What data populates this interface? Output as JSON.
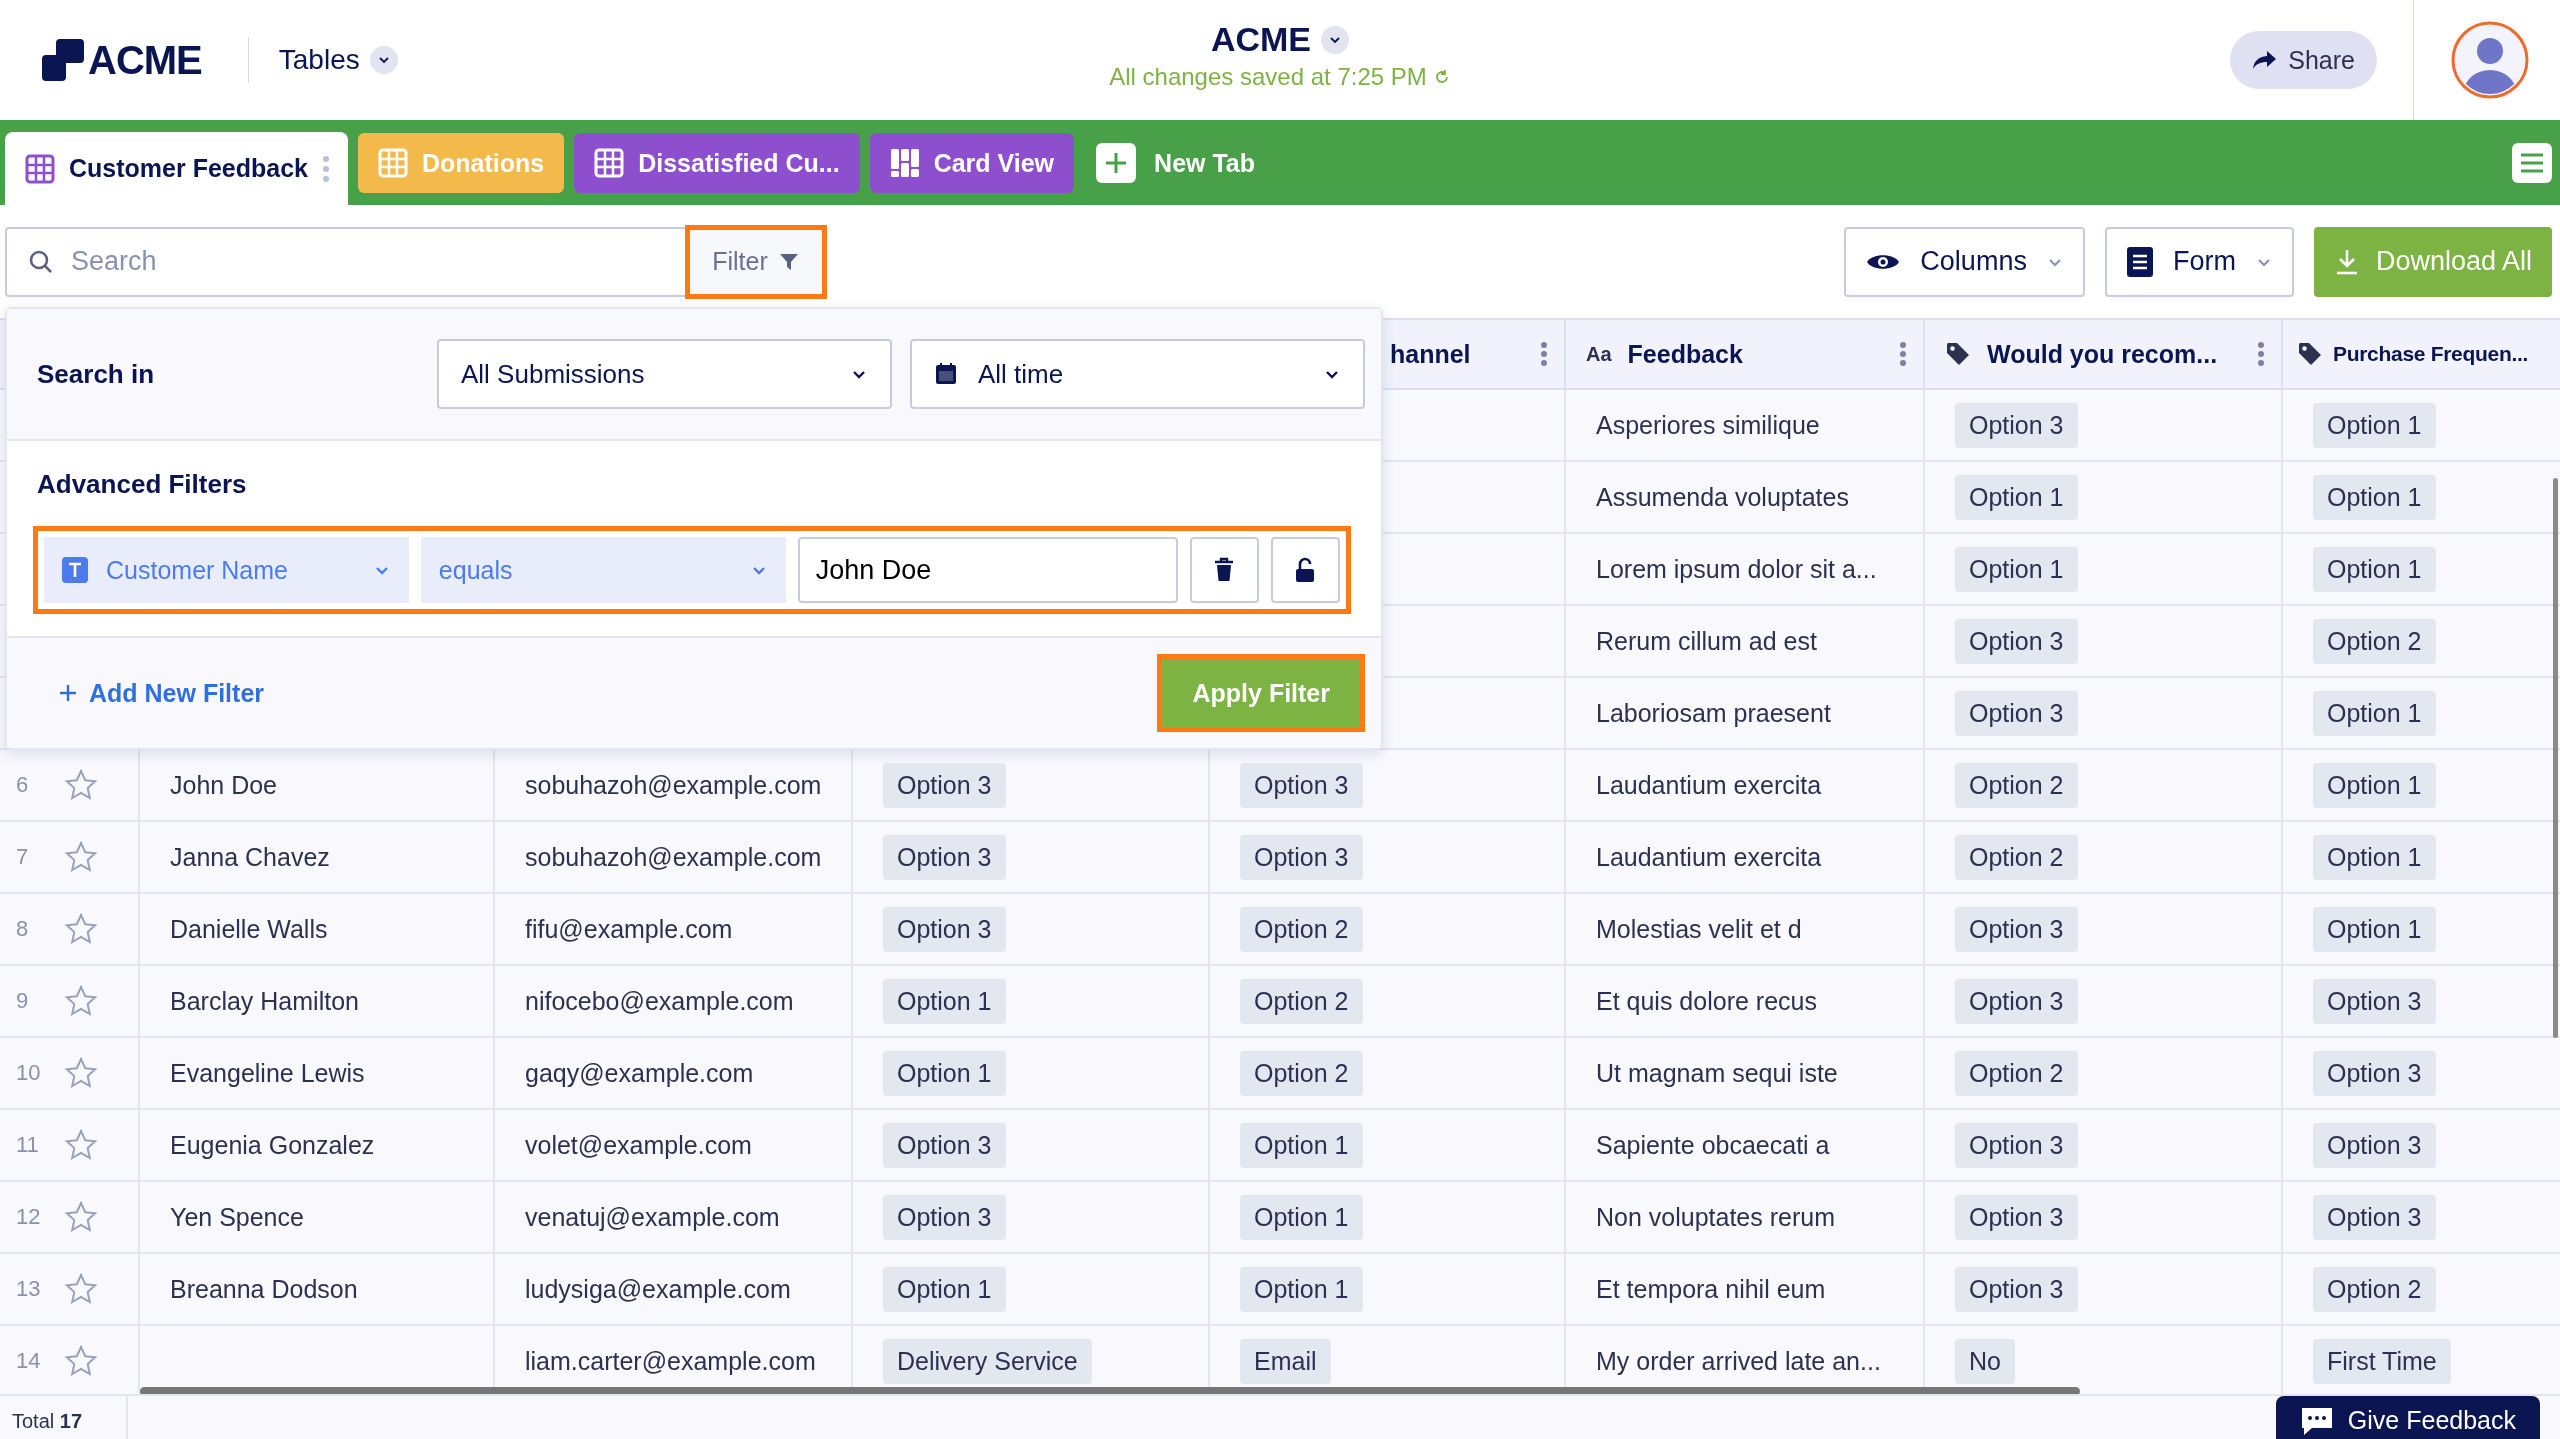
{
  "header": {
    "logo": "ACME",
    "app_menu": "Tables",
    "title": "ACME",
    "status": "All changes saved at 7:25 PM",
    "share": "Share"
  },
  "tabs": [
    {
      "label": "Customer Feedback",
      "kind": "grid",
      "color": "#8e4fcf",
      "selected": true
    },
    {
      "label": "Donations",
      "kind": "grid",
      "color": "#f3b94a",
      "selected": false
    },
    {
      "label": "Dissatisfied Cu...",
      "kind": "grid",
      "color": "#8e4fcf",
      "selected": false
    },
    {
      "label": "Card View",
      "kind": "cards",
      "color": "#8e4fcf",
      "selected": false
    }
  ],
  "new_tab": "New Tab",
  "toolbar": {
    "search": {
      "placeholder": "Search"
    },
    "filter": {
      "label": "Filter",
      "highlighted": true
    },
    "columns": "Columns",
    "form": "Form",
    "download": "Download All"
  },
  "filter_panel": {
    "search_in_label": "Search in",
    "scope": "All Submissions",
    "period": "All time",
    "advanced_label": "Advanced Filters",
    "filters": [
      {
        "field": "Customer Name",
        "operator": "equals",
        "value": "John Doe",
        "highlighted": true
      }
    ],
    "add_filter": "Add New Filter",
    "apply": {
      "label": "Apply Filter",
      "highlighted": true
    }
  },
  "table": {
    "columns": [
      {
        "kind": "text"
      },
      {
        "kind": "text"
      },
      {
        "kind": "tag"
      },
      {
        "kind": "tag",
        "label": "hannel"
      },
      {
        "kind": "text",
        "label": "Feedback",
        "glyph": "Aa"
      },
      {
        "kind": "tag",
        "label": "Would you recom..."
      },
      {
        "kind": "tag",
        "label": "Purchase Frequen..."
      }
    ],
    "rows": [
      {
        "cells": [
          null,
          null,
          null,
          null,
          "Asperiores similique",
          "Option 3",
          "Option 1"
        ]
      },
      {
        "cells": [
          null,
          null,
          null,
          null,
          "Assumenda voluptates",
          "Option 1",
          "Option 1"
        ]
      },
      {
        "cells": [
          null,
          null,
          null,
          null,
          "Lorem ipsum dolor sit a...",
          "Option 1",
          "Option 1"
        ]
      },
      {
        "cells": [
          null,
          null,
          null,
          null,
          "Rerum cillum ad est",
          "Option 3",
          "Option 2"
        ]
      },
      {
        "cells": [
          null,
          null,
          null,
          null,
          "Laboriosam praesent",
          "Option 3",
          "Option 1"
        ]
      },
      {
        "number": "6",
        "starred": false,
        "cells": [
          "John Doe",
          "sobuhazoh@example.com",
          "Option 3",
          "Option 3",
          "Laudantium exercita",
          "Option 2",
          "Option 1"
        ]
      },
      {
        "number": "7",
        "starred": false,
        "cells": [
          "Janna Chavez",
          "sobuhazoh@example.com",
          "Option 3",
          "Option 3",
          "Laudantium exercita",
          "Option 2",
          "Option 1"
        ]
      },
      {
        "number": "8",
        "starred": false,
        "cells": [
          "Danielle Walls",
          "fifu@example.com",
          "Option 3",
          "Option 2",
          "Molestias velit et d",
          "Option 3",
          "Option 1"
        ]
      },
      {
        "number": "9",
        "starred": false,
        "cells": [
          "Barclay Hamilton",
          "nifocebo@example.com",
          "Option 1",
          "Option 2",
          "Et quis dolore recus",
          "Option 3",
          "Option 3"
        ]
      },
      {
        "number": "10",
        "starred": false,
        "cells": [
          "Evangeline Lewis",
          "gaqy@example.com",
          "Option 1",
          "Option 2",
          "Ut magnam sequi iste",
          "Option 2",
          "Option 3"
        ]
      },
      {
        "number": "11",
        "starred": false,
        "cells": [
          "Eugenia Gonzalez",
          "volet@example.com",
          "Option 3",
          "Option 1",
          "Sapiente obcaecati a",
          "Option 3",
          "Option 3"
        ]
      },
      {
        "number": "12",
        "starred": false,
        "cells": [
          "Yen Spence",
          "venatuj@example.com",
          "Option 3",
          "Option 1",
          "Non voluptates rerum",
          "Option 3",
          "Option 3"
        ]
      },
      {
        "number": "13",
        "starred": false,
        "cells": [
          "Breanna Dodson",
          "ludysiga@example.com",
          "Option 1",
          "Option 1",
          "Et tempora nihil eum",
          "Option 3",
          "Option 2"
        ]
      },
      {
        "number": "14",
        "starred": false,
        "cells": [
          null,
          "liam.carter@example.com",
          "Delivery Service",
          "Email",
          "My order arrived late an...",
          "No",
          "First Time"
        ]
      }
    ]
  },
  "footer": {
    "total": "Total **17**",
    "feedback_button": "Give Feedback"
  }
}
